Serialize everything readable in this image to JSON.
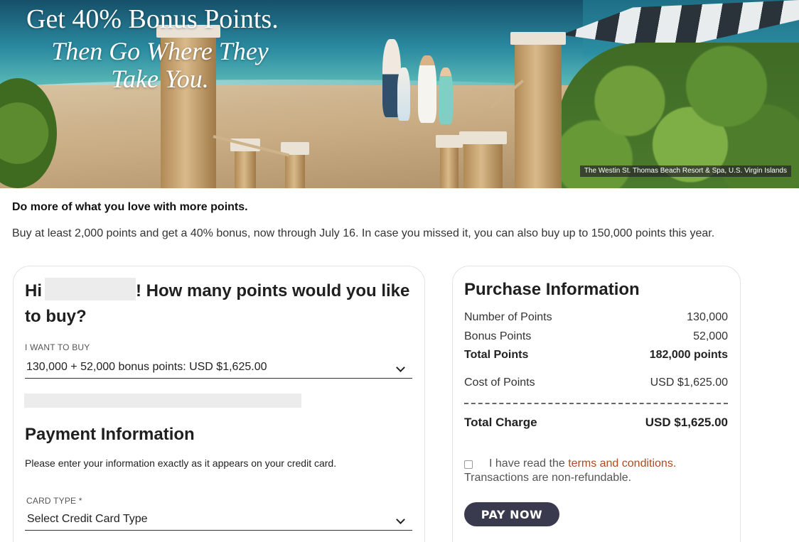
{
  "hero": {
    "title": "Get 40% Bonus Points.",
    "subtitle": "Then Go Where They Take You.",
    "caption": "The Westin St. Thomas Beach Resort & Spa, U.S. Virgin Islands"
  },
  "intro": {
    "title": "Do more of what you love with more points.",
    "body": "Buy at least 2,000 points and get a 40% bonus, now through July 16. In case you missed it, you can also buy up to 150,000 points this year."
  },
  "purchase_form": {
    "greeting_prefix": "Hi",
    "greeting_suffix": "! How many points would you like to buy?",
    "want_label": "I WANT TO BUY",
    "want_value": "130,000 + 52,000 bonus points: USD $1,625.00"
  },
  "payment": {
    "title": "Payment Information",
    "note": "Please enter your information exactly as it appears on your credit card.",
    "card_type_label": "CARD TYPE *",
    "card_type_value": "Select Credit Card Type"
  },
  "purchase_info": {
    "title": "Purchase Information",
    "rows": [
      {
        "label": "Number of Points",
        "value": "130,000"
      },
      {
        "label": "Bonus Points",
        "value": "52,000"
      },
      {
        "label": "Total Points",
        "value": "182,000 points"
      },
      {
        "label": "Cost of Points",
        "value": "USD $1,625.00"
      },
      {
        "label": "Total Charge",
        "value": "USD $1,625.00"
      }
    ],
    "terms_prefix": "I have read the ",
    "terms_link": "terms and conditions.",
    "nonrefundable": "Transactions are non-refundable.",
    "pay_button": "PAY NOW"
  },
  "colors": {
    "button_bg": "#3a3a4e",
    "link": "#b0491f"
  }
}
